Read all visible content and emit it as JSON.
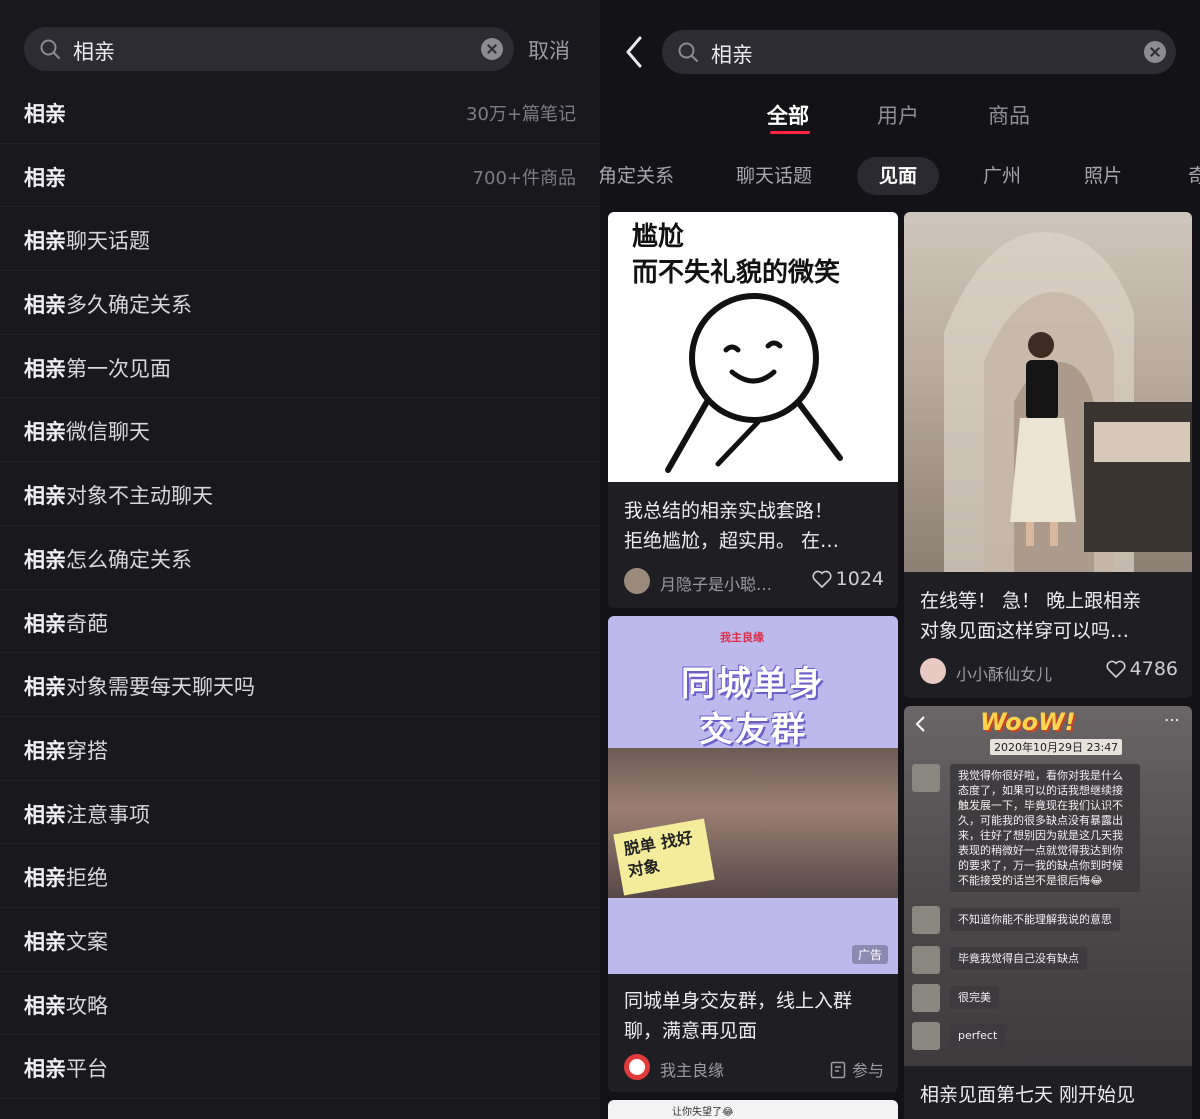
{
  "left": {
    "query": "相亲",
    "cancel_label": "取消",
    "suggestions": [
      {
        "bold": "相亲",
        "rest": "",
        "meta": "30万+篇笔记"
      },
      {
        "bold": "相亲",
        "rest": "",
        "meta": "700+件商品"
      },
      {
        "bold": "相亲",
        "rest": "聊天话题",
        "meta": ""
      },
      {
        "bold": "相亲",
        "rest": "多久确定关系",
        "meta": ""
      },
      {
        "bold": "相亲",
        "rest": "第一次见面",
        "meta": ""
      },
      {
        "bold": "相亲",
        "rest": "微信聊天",
        "meta": ""
      },
      {
        "bold": "相亲",
        "rest": "对象不主动聊天",
        "meta": ""
      },
      {
        "bold": "相亲",
        "rest": "怎么确定关系",
        "meta": ""
      },
      {
        "bold": "相亲",
        "rest": "奇葩",
        "meta": ""
      },
      {
        "bold": "相亲",
        "rest": "对象需要每天聊天吗",
        "meta": ""
      },
      {
        "bold": "相亲",
        "rest": "穿搭",
        "meta": ""
      },
      {
        "bold": "相亲",
        "rest": "注意事项",
        "meta": ""
      },
      {
        "bold": "相亲",
        "rest": "拒绝",
        "meta": ""
      },
      {
        "bold": "相亲",
        "rest": "文案",
        "meta": ""
      },
      {
        "bold": "相亲",
        "rest": "攻略",
        "meta": ""
      },
      {
        "bold": "相亲",
        "rest": "平台",
        "meta": ""
      }
    ]
  },
  "right": {
    "query": "相亲",
    "tabs": [
      "全部",
      "用户",
      "商品"
    ],
    "chips": [
      "角定关系",
      "聊天话题",
      "见面",
      "广州",
      "照片",
      "奇"
    ],
    "cards": {
      "c1": {
        "image_text": [
          "尴尬",
          "而不失礼貌的微笑"
        ],
        "title_lines": [
          "我总结的相亲实战套路！",
          "拒绝尴尬，超实用。 在…"
        ],
        "author": "月隐子是小聪…",
        "likes": "1024"
      },
      "c2": {
        "title_lines": [
          "在线等！ 急！ 晚上跟相亲",
          "对象见面这样穿可以吗…"
        ],
        "author": "小小酥仙女儿",
        "likes": "4786"
      },
      "c3": {
        "brand": "我主良缘",
        "headline": [
          "同城单身",
          "交友群"
        ],
        "note": "脱单 找好对象",
        "ad": "广告",
        "title_lines": [
          "同城单身交友群，线上入群",
          "聊，满意再见面"
        ],
        "author": "我主良缘",
        "action": "参与"
      },
      "c4": {
        "wow": "WooW!",
        "date": "2020年10月29日 23:47",
        "messages": [
          "我觉得你很好啦，看你对我是什么态度了，如果可以的话我想继续接触发展一下，毕竟现在我们认识不久，可能我的很多缺点没有暴露出来，往好了想别因为就是这几天我表现的稍微好一点就觉得我达到你的要求了，万一我的缺点你到时候不能接受的话岂不是很后悔😂",
          "不知道你能不能理解我说的意思",
          "毕竟我觉得自己没有缺点",
          "很完美",
          "perfect"
        ],
        "title_line": "相亲见面第七天 刚开始见"
      },
      "c5": {
        "snippet": "让你失望了😂"
      }
    },
    "colors": {
      "accent": "#ff2442",
      "background": "#131317",
      "card": "#1e1e23"
    }
  }
}
